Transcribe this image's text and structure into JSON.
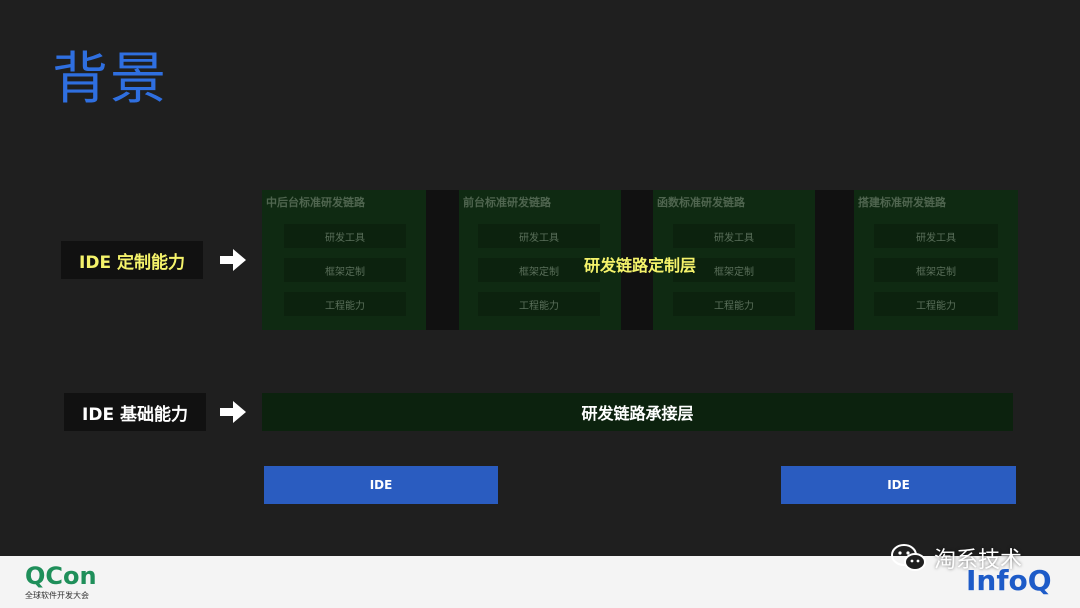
{
  "title": "背景",
  "labels": {
    "custom": "IDE 定制能力",
    "basic": "IDE 基础能力"
  },
  "custom_layer": {
    "label": "研发链路定制层",
    "columns": [
      {
        "title": "中后台标准研发链路",
        "tools": [
          "研发工具",
          "框架定制",
          "工程能力"
        ]
      },
      {
        "title": "前台标准研发链路",
        "tools": [
          "研发工具",
          "框架定制",
          "工程能力"
        ]
      },
      {
        "title": "函数标准研发链路",
        "tools": [
          "研发工具",
          "框架定制",
          "工程能力"
        ]
      },
      {
        "title": "搭建标准研发链路",
        "tools": [
          "研发工具",
          "框架定制",
          "工程能力"
        ]
      }
    ]
  },
  "connect_layer": {
    "label": "研发链路承接层"
  },
  "ide_boxes": [
    "IDE",
    "IDE"
  ],
  "footer": {
    "qcon_logo": "QCon",
    "qcon_sub": "全球软件开发大会",
    "infoq_logo": "InfoQ",
    "watermark": "淘系技术"
  },
  "colors": {
    "background": "#1f1f1f",
    "title": "#2f6fe0",
    "highlight_yellow": "#f5f36b",
    "ide_blue": "#2a5cc0",
    "layer_green": "#0f2a12"
  },
  "icons": [
    "right-arrow-icon",
    "wechat-icon"
  ]
}
